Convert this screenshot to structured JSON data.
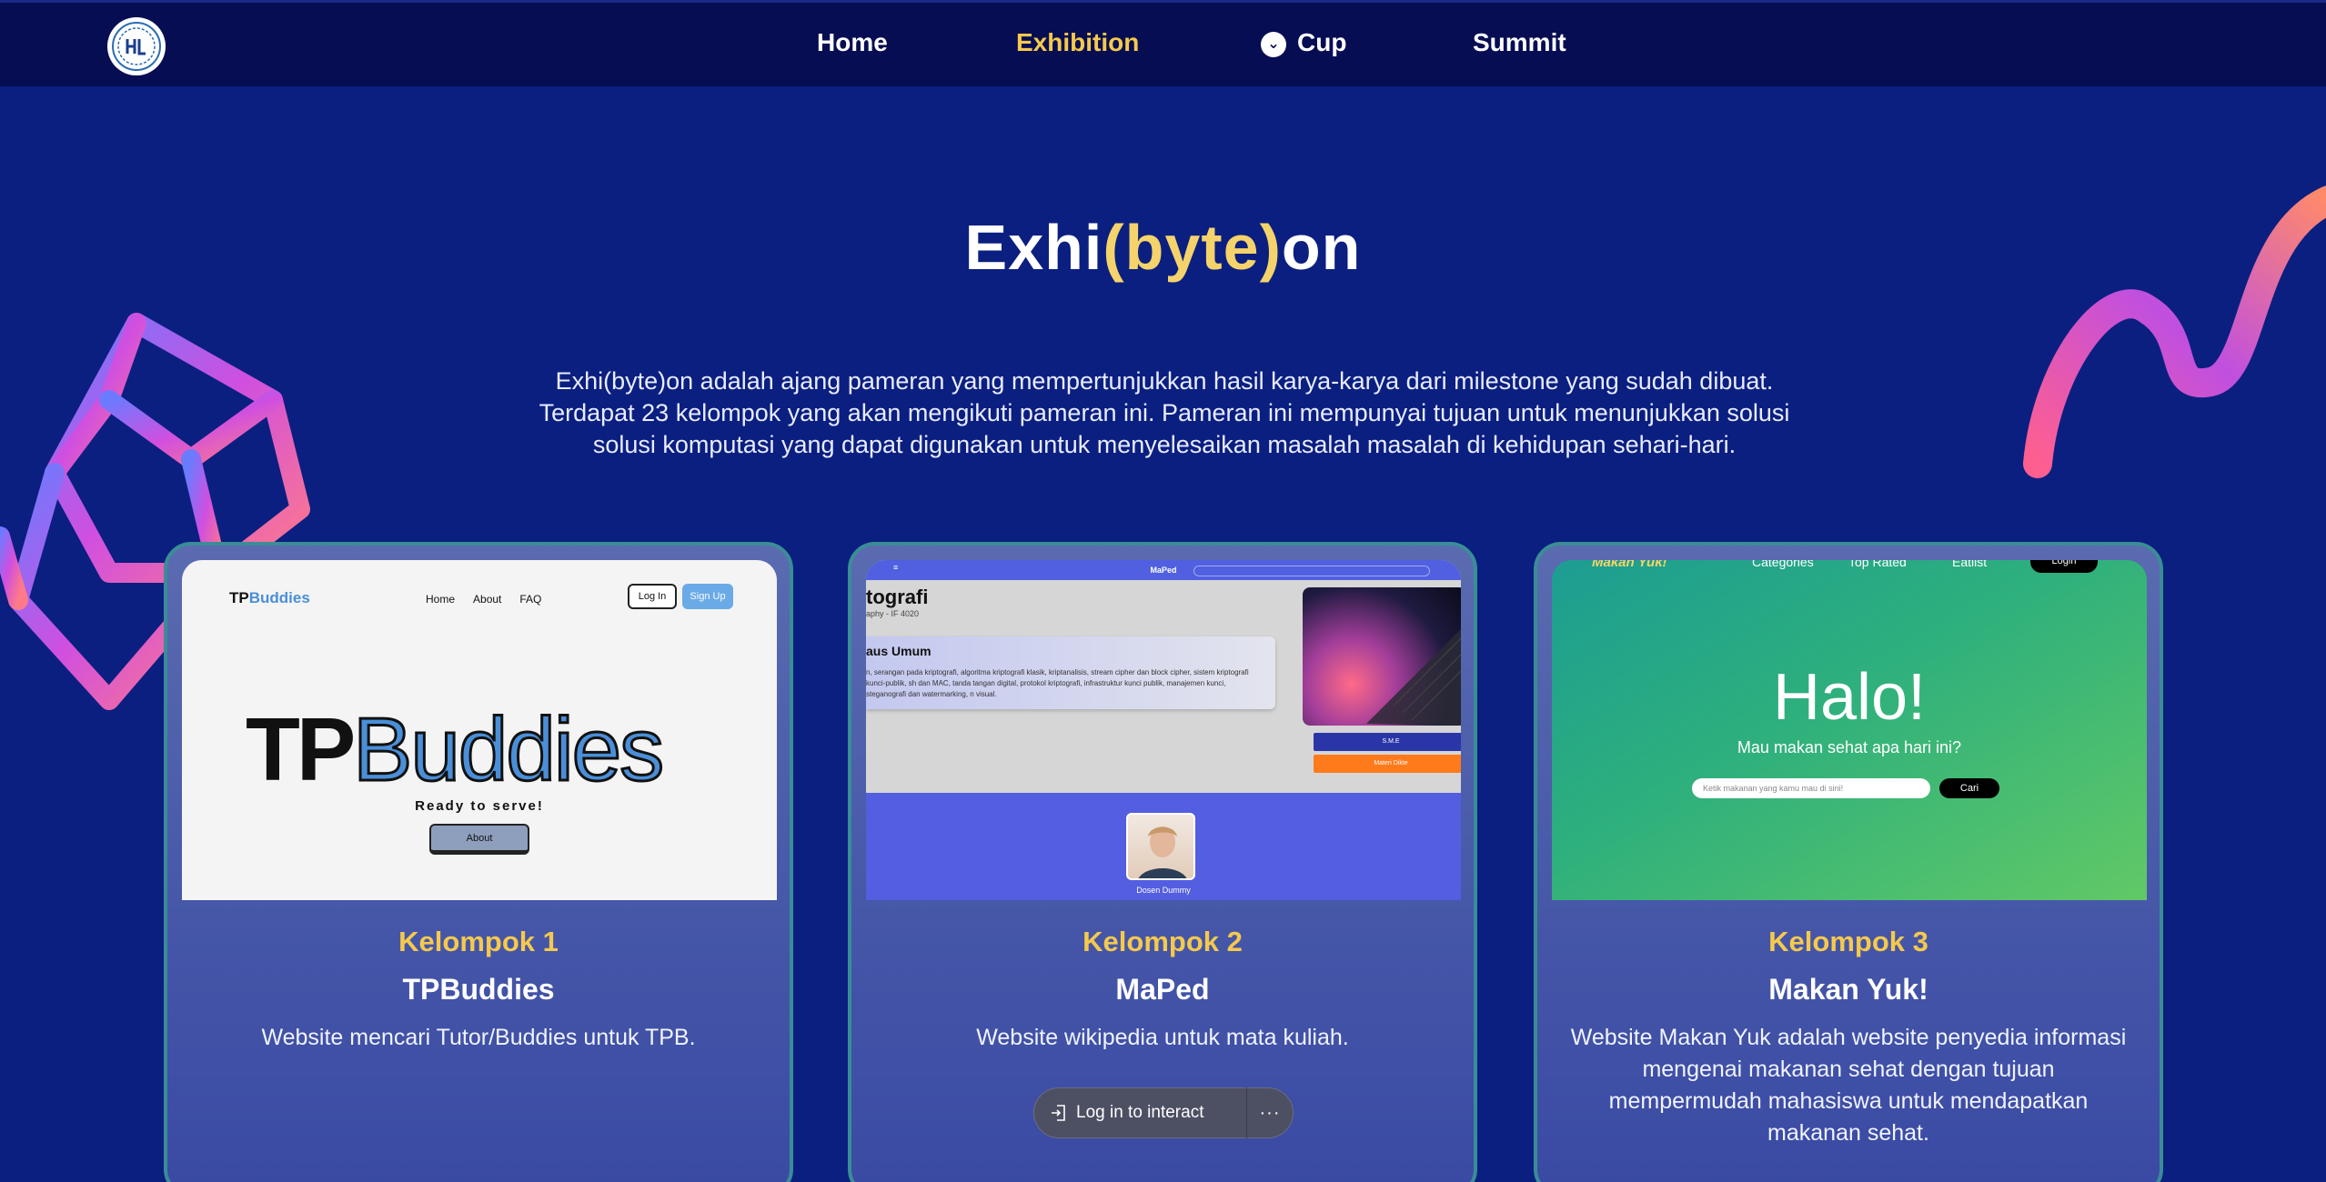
{
  "nav": {
    "logo_icon": "hmif-logo-icon",
    "items": [
      {
        "label": "Home",
        "active": false
      },
      {
        "label": "Exhibition",
        "active": true
      },
      {
        "label": "Cup",
        "active": false,
        "icon": "chevron-down-icon"
      },
      {
        "label": "Summit",
        "active": false
      }
    ]
  },
  "hero": {
    "title_pre": "Exhi",
    "title_hl": "(byte)",
    "title_post": "on",
    "description_lines": [
      "Exhi(byte)on adalah ajang pameran yang mempertunjukkan hasil karya-karya dari milestone yang sudah dibuat.",
      "Terdapat 23 kelompok yang akan mengikuti pameran ini. Pameran ini mempunyai tujuan untuk menunjukkan solusi",
      "solusi komputasi yang dapat digunakan untuk menyelesaikan masalah masalah di kehidupan sehari-hari."
    ]
  },
  "cards": [
    {
      "group": "Kelompok 1",
      "name": "TPBuddies",
      "description": "Website mencari Tutor/Buddies untuk TPB.",
      "shot": {
        "logo_a": "TP",
        "logo_b": "Buddies",
        "links": [
          "Home",
          "About",
          "FAQ"
        ],
        "login": "Log In",
        "signup": "Sign Up",
        "tagline": "Ready to serve!",
        "about_button": "About"
      }
    },
    {
      "group": "Kelompok 2",
      "name": "MaPed",
      "description": "Website wikipedia untuk mata kuliah.",
      "shot": {
        "bar_title": "MaPed",
        "heading": "tografi",
        "sub": "aphy - IF 4020",
        "box_title": "aus Umum",
        "box_text": "n, serangan pada kriptografi, algoritma kriptografi klasik, kriptanalisis, stream cipher dan block cipher, sistem kriptografi kunci-publik, sh dan MAC, tanda tangan digital, protokol kriptografi, infrastruktur kunci publik, manajemen kunci, steganografi dan watermarking, n visual.",
        "btn1": "S.M.E",
        "btn2": "Materi Dikte",
        "person": "Dosen Dummy"
      }
    },
    {
      "group": "Kelompok 3",
      "name": "Makan Yuk!",
      "description": "Website Makan Yuk adalah website penyedia informasi mengenai makanan sehat dengan tujuan mempermudah mahasiswa untuk mendapatkan makanan sehat.",
      "shot": {
        "brand": "Makan Yuk!",
        "links": [
          "Categories",
          "Top Rated",
          "Eatlist"
        ],
        "login": "Login",
        "greeting": "Halo!",
        "question": "Mau makan sehat apa hari ini?",
        "search_placeholder": "Ketik makanan yang kamu mau di sini!",
        "search_button": "Cari"
      }
    }
  ],
  "toast": {
    "label": "Log in to interact",
    "more": "···",
    "icon": "login-arrow-icon"
  },
  "colors": {
    "background": "#0b1f80",
    "nav": "#060d52",
    "accent": "#f5c94c",
    "card_border": "#3a8d96"
  }
}
